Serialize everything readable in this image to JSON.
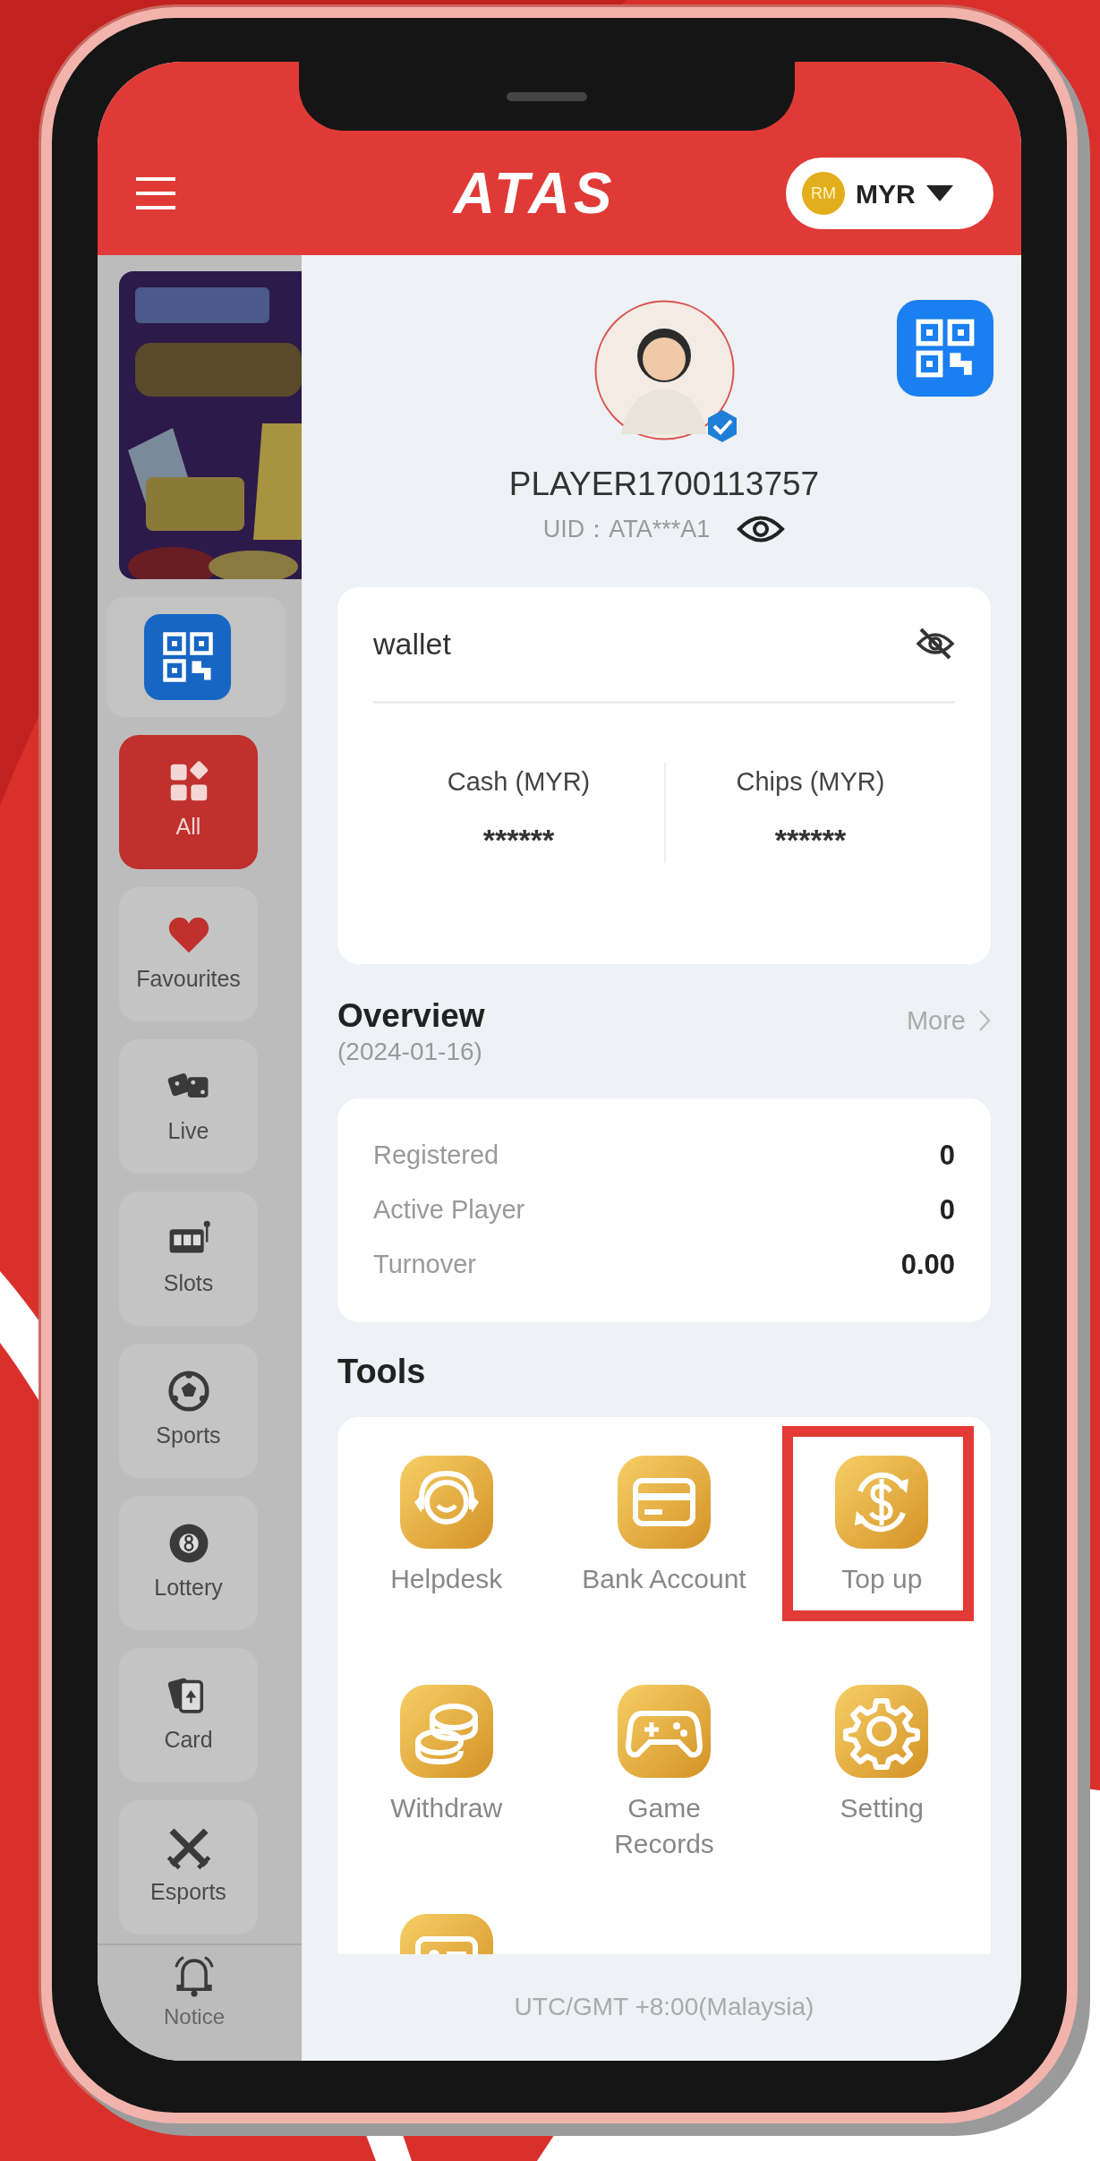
{
  "header": {
    "logo": "ATAS",
    "currency_coin": "RM",
    "currency": "MYR"
  },
  "sidebar": {
    "items": [
      {
        "label": "All",
        "kind": "grid",
        "selected": true
      },
      {
        "label": "Favourites",
        "kind": "heart",
        "selected": false
      },
      {
        "label": "Live",
        "kind": "dice",
        "selected": false
      },
      {
        "label": "Slots",
        "kind": "slot",
        "selected": false
      },
      {
        "label": "Sports",
        "kind": "ball",
        "selected": false
      },
      {
        "label": "Lottery",
        "kind": "eightball",
        "selected": false
      },
      {
        "label": "Card",
        "kind": "cards",
        "selected": false
      },
      {
        "label": "Esports",
        "kind": "swords",
        "selected": false
      }
    ],
    "notice": {
      "label": "Notice"
    }
  },
  "profile": {
    "username": "PLAYER1700113757",
    "uid": "UID：ATA***A1",
    "verified": true
  },
  "wallet": {
    "title": "wallet",
    "hidden": true,
    "balances": [
      {
        "label": "Cash (MYR)",
        "value": "******"
      },
      {
        "label": "Chips (MYR)",
        "value": "******"
      }
    ]
  },
  "overview": {
    "title": "Overview",
    "date": "(2024-01-16)",
    "more": "More",
    "rows": [
      {
        "label": "Registered",
        "value": "0"
      },
      {
        "label": "Active Player",
        "value": "0"
      },
      {
        "label": "Turnover",
        "value": "0.00"
      }
    ]
  },
  "tools": {
    "title": "Tools",
    "items": [
      {
        "label": "Helpdesk",
        "kind": "headset",
        "highlighted": false
      },
      {
        "label": "Bank Account",
        "kind": "card",
        "highlighted": false
      },
      {
        "label": "Top up",
        "kind": "exchange",
        "highlighted": true
      },
      {
        "label": "Withdraw",
        "kind": "coins",
        "highlighted": false
      },
      {
        "label": "Game Records",
        "kind": "gamepad",
        "highlighted": false
      },
      {
        "label": "Setting",
        "kind": "gear",
        "highlighted": false
      },
      {
        "kind": "idcard",
        "highlighted": false
      }
    ]
  },
  "footer": "UTC/GMT +8:00(Malaysia)"
}
